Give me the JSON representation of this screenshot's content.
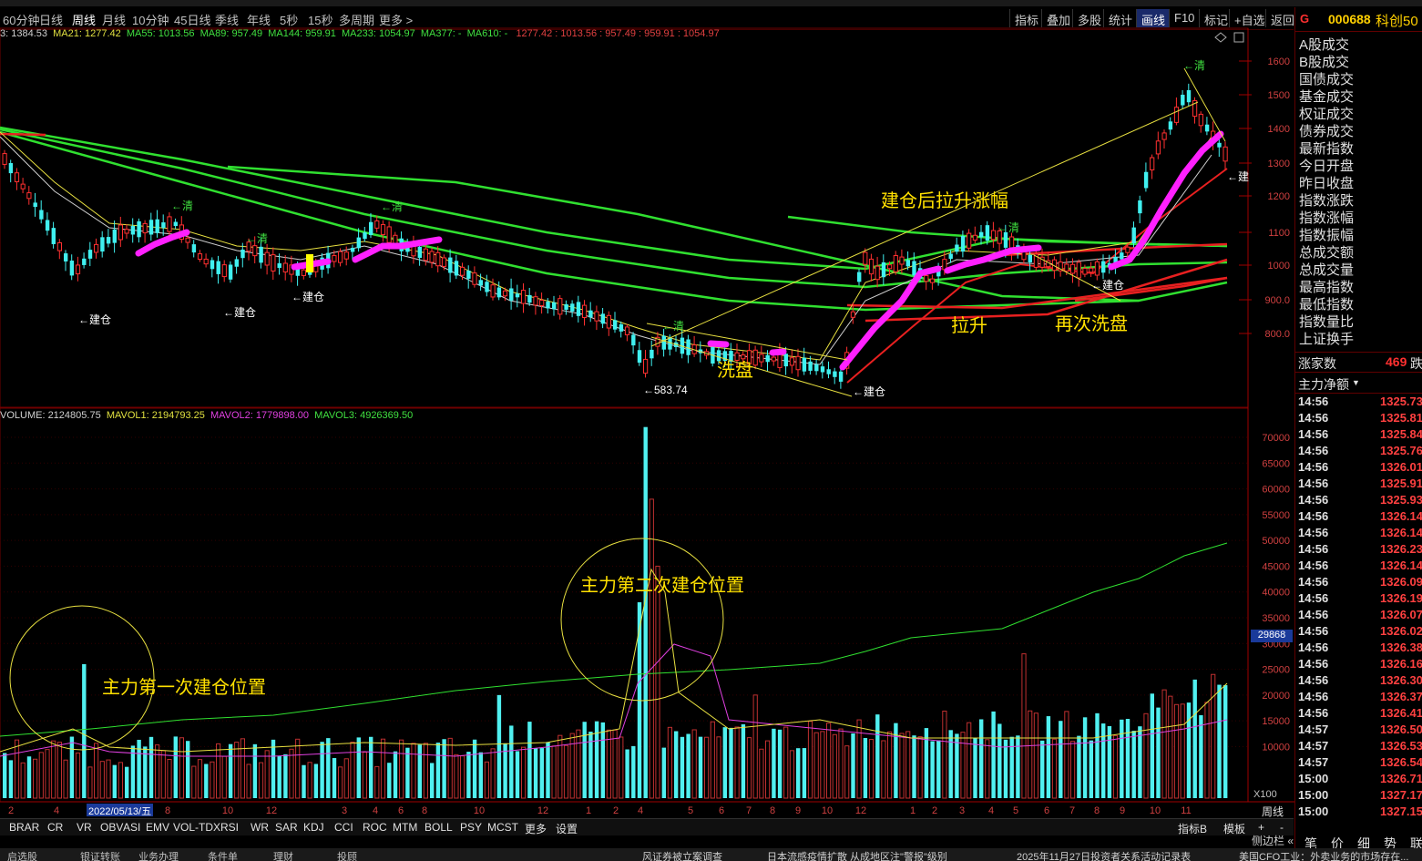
{
  "period_bar": {
    "items": [
      "60分钟",
      "日线",
      "周线",
      "月线",
      "10分钟",
      "45日线",
      "季线",
      "年线",
      "5秒",
      "15秒",
      "多周期",
      "更多 >"
    ],
    "active": "周线",
    "tools": [
      "指标",
      "叠加",
      "多股",
      "统计",
      "画线",
      "F10",
      "标记",
      "+自选",
      "返回"
    ],
    "active_tool": "画线"
  },
  "ma_line": {
    "head": "3: 1384.53",
    "ma21": "MA21: 1277.42",
    "ma55": "MA55: 1013.56",
    "ma89": "MA89: 957.49",
    "ma144": "MA144: 959.91",
    "ma233": "MA233: 1054.97",
    "ma377": "MA377: -",
    "ma610": "MA610: -",
    "tail": "1277.42 : 1013.56 : 957.49 : 959.91 : 1054.97"
  },
  "price_axis": [
    "1600",
    "1500",
    "1400",
    "1300",
    "1200",
    "1100",
    "1000",
    "900.0",
    "800.0"
  ],
  "vol_axis": [
    "70000",
    "65000",
    "60000",
    "55000",
    "50000",
    "45000",
    "40000",
    "35000",
    "30000",
    "25000",
    "20000",
    "15000",
    "10000"
  ],
  "vol_cursor": "29868",
  "vol_unit": "X100",
  "vol_line": {
    "volume": "VOLUME: 2124805.75",
    "mavol1": "MAVOL1: 2194793.25",
    "mavol2": "MAVOL2: 1779898.00",
    "mavol3": "MAVOL3: 4926369.50"
  },
  "x_axis": {
    "labels": [
      "2",
      "4",
      "8",
      "10",
      "12",
      "3",
      "4",
      "6",
      "8",
      "10",
      "12",
      "1",
      "2",
      "4",
      "5",
      "6",
      "7",
      "8",
      "9",
      "10",
      "12",
      "1",
      "2",
      "3",
      "4",
      "5",
      "6",
      "7",
      "8",
      "9",
      "10",
      "11"
    ],
    "cursor_date": "2022/05/13/五",
    "period": "周线"
  },
  "annotations": {
    "first_build": "主力第一次建仓位置",
    "second_build": "主力第二次建仓位置",
    "rise_after_build": "建仓后拉升涨幅",
    "wash": "洗盘",
    "lift": "拉升",
    "wash_again": "再次洗盘",
    "low_price": "←583.74"
  },
  "tags": {
    "build": "←建仓",
    "clear": "←清",
    "build_short": "←建"
  },
  "indicator_tabs": [
    "BRAR",
    "CR",
    "VR",
    "OBV",
    "ASI",
    "EMV",
    "VOL-TDX",
    "RSI",
    "WR",
    "SAR",
    "KDJ",
    "CCI",
    "ROC",
    "MTM",
    "BOLL",
    "PSY",
    "MCST",
    "更多",
    "设置"
  ],
  "indicator_right": [
    "指标B",
    "模板",
    "+",
    "-"
  ],
  "right_panel": {
    "code": "000688",
    "name": "科创50",
    "g": "G",
    "menu": [
      "A股成交",
      "B股成交",
      "国债成交",
      "基金成交",
      "权证成交",
      "债券成交",
      "最新指数",
      "今日开盘",
      "昨日收盘",
      "指数涨跌",
      "指数涨幅",
      "指数振幅",
      "总成交额",
      "总成交量",
      "最高指数",
      "最低指数",
      "指数量比",
      "上证换手"
    ],
    "rise_label": "涨家数",
    "rise_value": "469",
    "fall_label": "跌",
    "flow_label": "主力净额",
    "ticks": [
      {
        "t": "14:56",
        "p": "1325.73"
      },
      {
        "t": "14:56",
        "p": "1325.81"
      },
      {
        "t": "14:56",
        "p": "1325.84"
      },
      {
        "t": "14:56",
        "p": "1325.76"
      },
      {
        "t": "14:56",
        "p": "1326.01"
      },
      {
        "t": "14:56",
        "p": "1325.91"
      },
      {
        "t": "14:56",
        "p": "1325.93"
      },
      {
        "t": "14:56",
        "p": "1326.14"
      },
      {
        "t": "14:56",
        "p": "1326.14"
      },
      {
        "t": "14:56",
        "p": "1326.23"
      },
      {
        "t": "14:56",
        "p": "1326.14"
      },
      {
        "t": "14:56",
        "p": "1326.09"
      },
      {
        "t": "14:56",
        "p": "1326.19"
      },
      {
        "t": "14:56",
        "p": "1326.07"
      },
      {
        "t": "14:56",
        "p": "1326.02"
      },
      {
        "t": "14:56",
        "p": "1326.38"
      },
      {
        "t": "14:56",
        "p": "1326.16"
      },
      {
        "t": "14:56",
        "p": "1326.30"
      },
      {
        "t": "14:56",
        "p": "1326.37"
      },
      {
        "t": "14:56",
        "p": "1326.41"
      },
      {
        "t": "14:57",
        "p": "1326.50"
      },
      {
        "t": "14:57",
        "p": "1326.53"
      },
      {
        "t": "14:57",
        "p": "1326.54"
      },
      {
        "t": "15:00",
        "p": "1326.71"
      },
      {
        "t": "15:00",
        "p": "1327.17"
      },
      {
        "t": "15:00",
        "p": "1327.15"
      }
    ],
    "side_label": "侧边栏 «",
    "bottom_tabs": [
      "笔",
      "价",
      "细",
      "势",
      "联"
    ]
  },
  "status_bar": {
    "items": [
      "启选股",
      "银证转账",
      "业务办理",
      "条件单",
      "理财",
      "投顾"
    ],
    "news": [
      "风证券被立案调查",
      "日本流感疫情扩散 从成地区注\"警报\"级别",
      "2025年11月27日投资者关系活动记录表",
      "美国CFO工业：外卖业务的市场存在..."
    ]
  },
  "colors": {
    "up": "#ff3030",
    "down": "#40f0f0",
    "ma_green": "#30e030",
    "ma_red": "#e82020",
    "magenta": "#ff20ff",
    "annotation": "#ffe000"
  }
}
